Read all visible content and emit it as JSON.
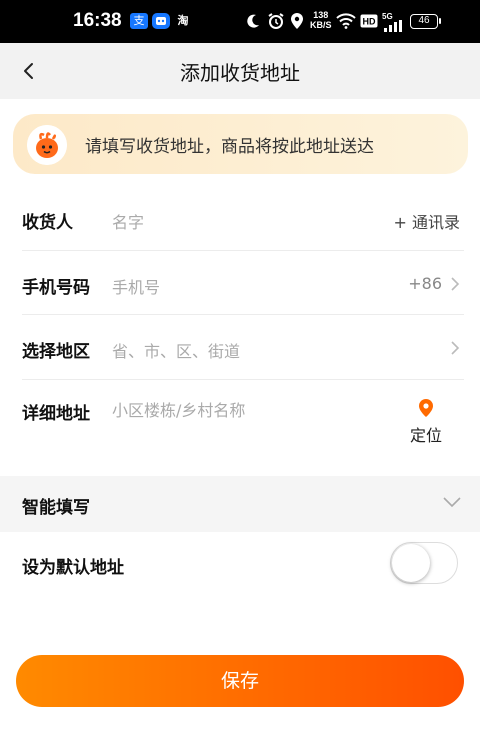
{
  "status_bar": {
    "time": "16:38",
    "speed_value": "138",
    "speed_unit": "KB/S",
    "network": "5G",
    "battery": "46"
  },
  "header": {
    "title": "添加收货地址"
  },
  "banner": {
    "text": "请填写收货地址，商品将按此地址送达"
  },
  "form": {
    "recipient": {
      "label": "收货人",
      "placeholder": "名字",
      "action": "+ 通讯录"
    },
    "phone": {
      "label": "手机号码",
      "placeholder": "手机号",
      "prefix": "+86"
    },
    "region": {
      "label": "选择地区",
      "placeholder": "省、市、区、街道"
    },
    "address": {
      "label": "详细地址",
      "placeholder": "小区楼栋/乡村名称",
      "locate": "定位"
    }
  },
  "smart_fill": {
    "label": "智能填写"
  },
  "default_address": {
    "label": "设为默认地址",
    "enabled": false
  },
  "save_button": {
    "label": "保存"
  },
  "colors": {
    "accent": "#ff5000",
    "accent_start": "#ff8a00",
    "banner_bg": "#fdf0d5",
    "pin": "#ff6a00"
  }
}
